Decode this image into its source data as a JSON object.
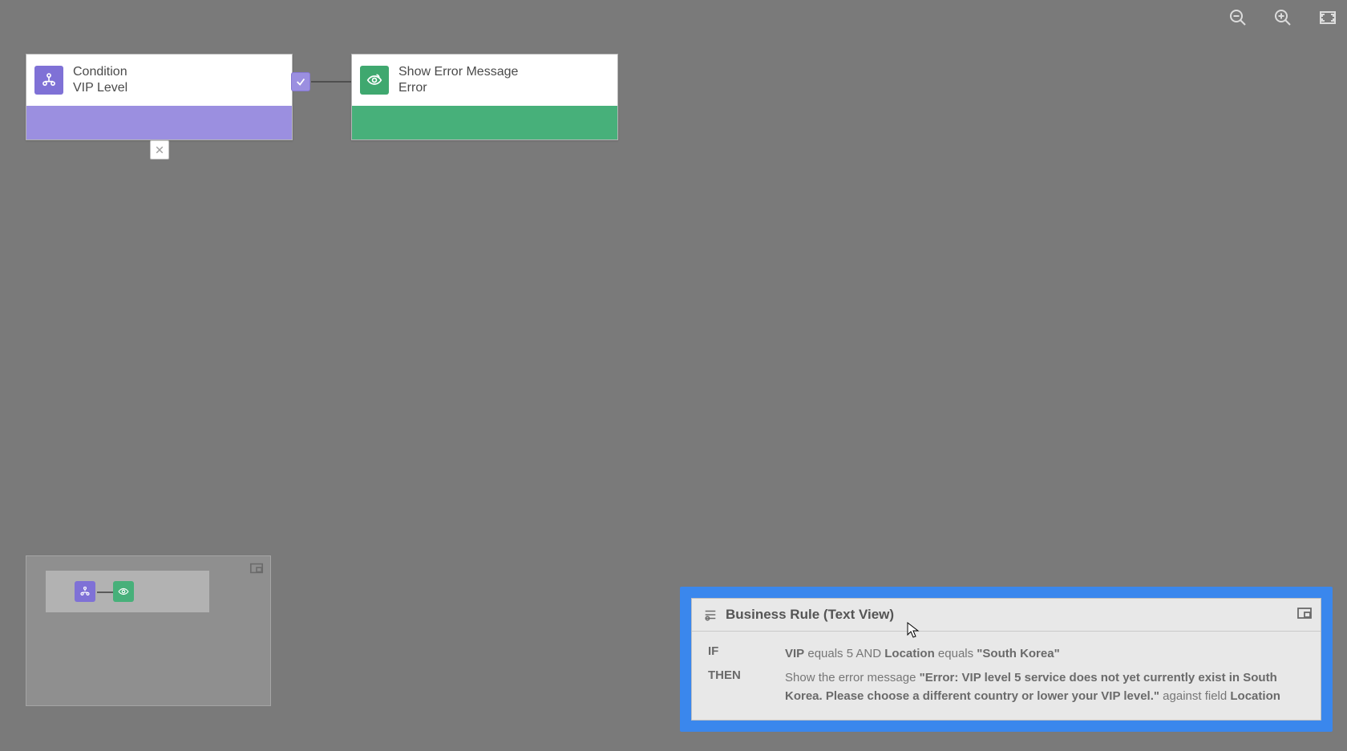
{
  "nodes": {
    "condition": {
      "title": "Condition",
      "subtitle": "VIP Level"
    },
    "action": {
      "title": "Show Error Message",
      "subtitle": "Error"
    }
  },
  "textview": {
    "title": "Business Rule (Text View)",
    "if_label": "IF",
    "then_label": "THEN",
    "if_expr": {
      "field1": "VIP",
      "op1": "equals",
      "val1": "5",
      "conj": "AND",
      "field2": "Location",
      "op2": "equals",
      "val2": "\"South Korea\""
    },
    "then_expr": {
      "prefix": "Show the error message ",
      "message": "\"Error: VIP level 5 service does not yet currently exist in South Korea. Please choose a different country or lower your VIP level.\"",
      "against": " against field ",
      "field": "Location"
    }
  }
}
